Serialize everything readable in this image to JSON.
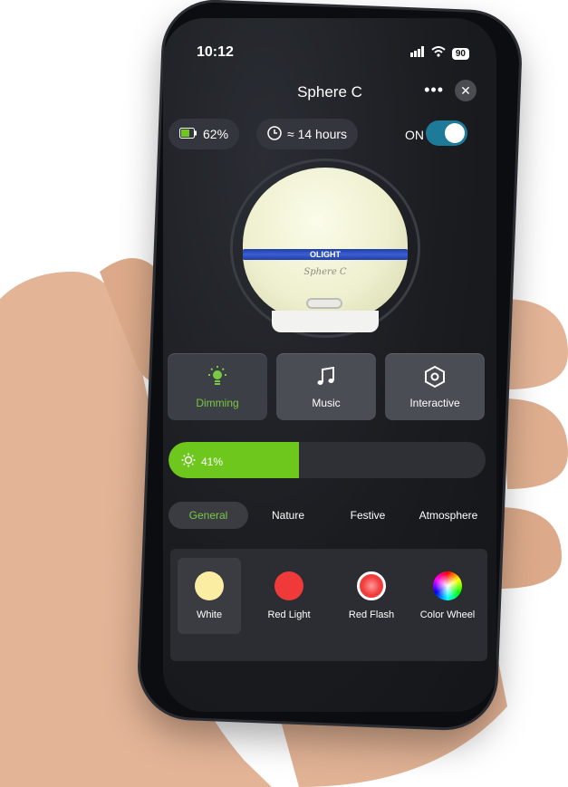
{
  "status_bar": {
    "time": "10:12",
    "battery": "90"
  },
  "header": {
    "title": "Sphere C",
    "more_icon": "more-icon",
    "close_icon": "close-icon"
  },
  "info": {
    "battery_level": "62%",
    "runtime": "≈ 14 hours",
    "power_label": "ON",
    "power_on": true
  },
  "lamp": {
    "brand": "OLIGHT",
    "model": "Sphere C"
  },
  "modes": [
    {
      "label": "Dimming",
      "icon": "bulb-icon",
      "active": true
    },
    {
      "label": "Music",
      "icon": "music-note-icon",
      "active": false
    },
    {
      "label": "Interactive",
      "icon": "hexagon-icon",
      "active": false
    }
  ],
  "brightness": {
    "label": "41%",
    "value": 0.41
  },
  "categories": [
    {
      "label": "General",
      "active": true
    },
    {
      "label": "Nature",
      "active": false
    },
    {
      "label": "Festive",
      "active": false
    },
    {
      "label": "Atmosphere",
      "active": false
    }
  ],
  "presets": [
    {
      "label": "White",
      "color": "#fbeea2",
      "selected": true
    },
    {
      "label": "Red Light",
      "color": "#f03a3a",
      "selected": false
    },
    {
      "label": "Red Flash",
      "color": "#f23b3b",
      "selected": false
    },
    {
      "label": "Color Wheel",
      "color": "rainbow",
      "selected": false
    }
  ],
  "colors": {
    "accent_green": "#6dc71c",
    "toggle_blue": "#1e7a99",
    "lamp_band_blue": "#2f4fc4"
  }
}
